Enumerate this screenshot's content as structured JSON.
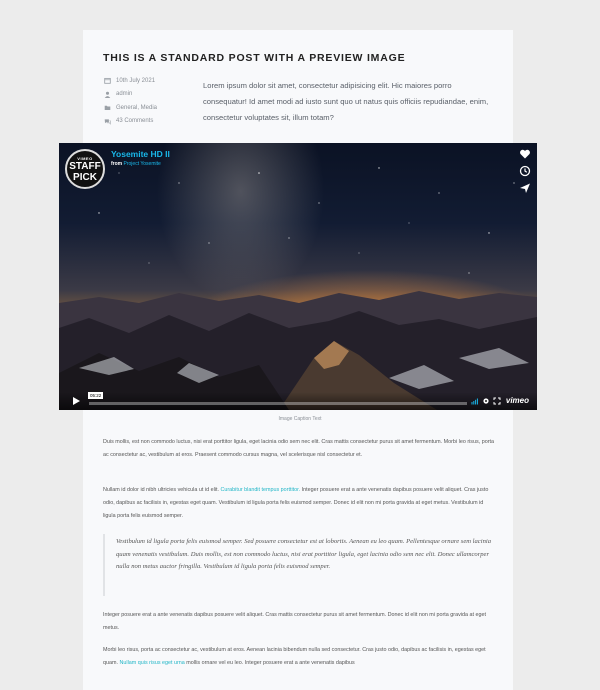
{
  "post": {
    "title": "This is a standard post with a preview image",
    "meta": {
      "date": "10th July 2021",
      "author": "admin",
      "categories": "General, Media",
      "comments": "43 Comments"
    },
    "excerpt": "Lorem ipsum dolor sit amet, consectetur adipisicing elit. Hic maiores porro consequatur! Id amet modi ad iusto sunt quo ut natus quis officiis repudiandae, enim, consectetur voluptates sit, illum totam?"
  },
  "video": {
    "badge_top": "VIMEO",
    "badge_line1": "STAFF",
    "badge_line2": "PICK",
    "title": "Yosemite HD II",
    "from_prefix": "from",
    "from_link": "Project Yosemite",
    "timecode": "05:22",
    "progress": 0.0,
    "brand": "vimeo",
    "icons": [
      "heart-icon",
      "clock-icon",
      "send-icon",
      "play-icon",
      "volume-icon",
      "settings-icon",
      "fullscreen-icon"
    ]
  },
  "caption": "Image Caption Text",
  "body": {
    "p1": "Duis mollis, est non commodo luctus, nisi erat porttitor ligula, eget lacinia odio sem nec elit. Cras mattis consectetur purus sit amet fermentum. Morbi leo risus, porta ac consectetur ac, vestibulum at eros. Praesent commodo cursus magna, vel scelerisque nisl consectetur et.",
    "p2_before": "Nullam id dolor id nibh ultricies vehicula ut id elit. ",
    "p2_link": "Curabitur blandit tempus porttitor.",
    "p2_after": " Integer posuere erat a ante venenatis dapibus posuere velit aliquet. Cras justo odio, dapibus ac facilisis in, egestas eget quam. Vestibulum id ligula porta felis euismod semper. Donec id elit non mi porta gravida at eget metus. Vestibulum id ligula porta felis euismod semper.",
    "quote": "Vestibulum id ligula porta felis euismod semper. Sed posuere consectetur est at lobortis. Aenean eu leo quam. Pellentesque ornare sem lacinia quam venenatis vestibulum. Duis mollis, est non commodo luctus, nisi erat porttitor ligula, eget lacinia odio sem nec elit. Donec ullamcorper nulla non metus auctor fringilla. Vestibulum id ligula porta felis euismod semper.",
    "p4": "Integer posuere erat a ante venenatis dapibus posuere velit aliquet. Cras mattis consectetur purus sit amet fermentum. Donec id elit non mi porta gravida at eget metus.",
    "p5_before": "Morbi leo risus, porta ac consectetur ac, vestibulum at eros. Aenean lacinia bibendum nulla sed consectetur. Cras justo odio, dapibus ac facilisis in, egestas eget quam. ",
    "p5_link": "Nullam quis risus eget urna",
    "p5_after": " mollis ornare vel eu leo. Integer posuere erat a ante venenatis dapibus"
  },
  "colors": {
    "accent": "#21b6c7",
    "vimeo_blue": "#19b7ea",
    "page_bg": "#ececec",
    "card_bg": "#f8f9fb"
  }
}
